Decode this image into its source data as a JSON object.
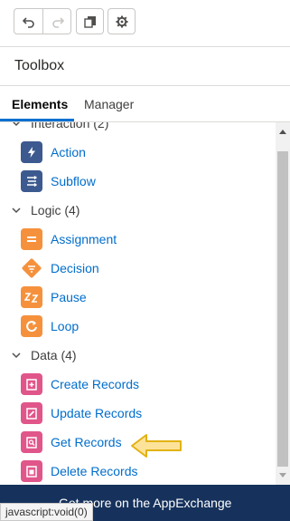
{
  "toolbar": {
    "undo_icon": "undo-icon",
    "redo_icon": "redo-icon",
    "copy_icon": "copy-icon",
    "settings_icon": "gear-icon"
  },
  "panel": {
    "title": "Toolbox"
  },
  "tabs": [
    {
      "label": "Elements",
      "active": true
    },
    {
      "label": "Manager",
      "active": false
    }
  ],
  "sections": {
    "interaction": "Interaction (2)",
    "logic": "Logic (4)",
    "data": "Data (4)"
  },
  "items": {
    "action": "Action",
    "subflow": "Subflow",
    "assignment": "Assignment",
    "decision": "Decision",
    "pause": "Pause",
    "loop": "Loop",
    "create": "Create Records",
    "update": "Update Records",
    "get": "Get Records",
    "delete": "Delete Records"
  },
  "colors": {
    "interaction": "#3c5a8f",
    "logic": "#f5913d",
    "data": "#e0568a",
    "link": "#006dcc",
    "footer": "#16325c",
    "arrow": "#f5c518"
  },
  "footer": {
    "text": "Get more on the AppExchange"
  },
  "status": {
    "text": "javascript:void(0)"
  }
}
